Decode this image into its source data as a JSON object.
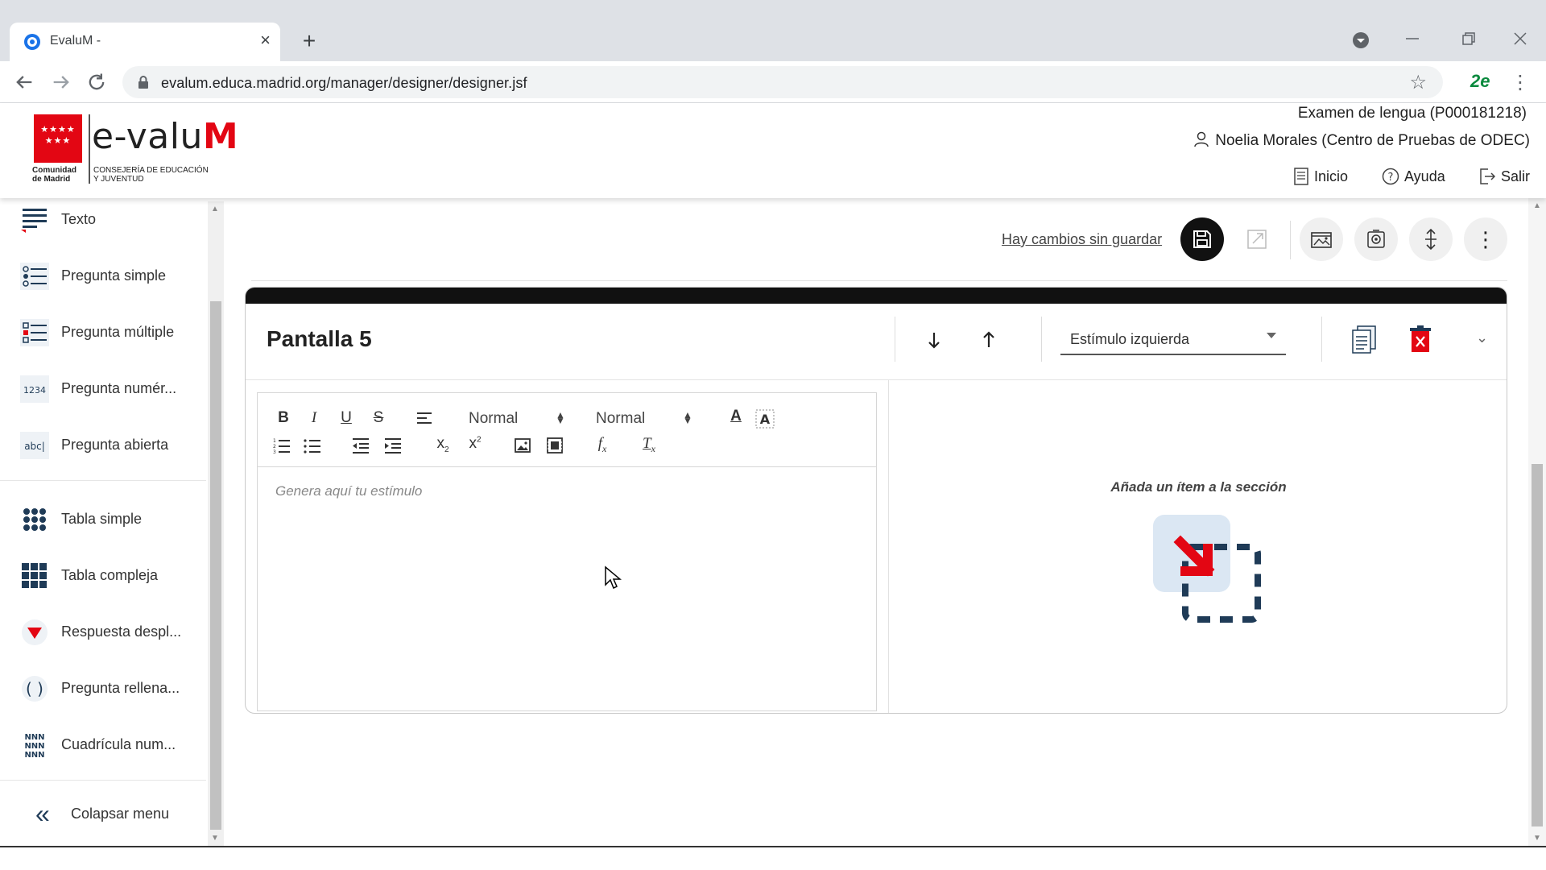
{
  "browser": {
    "tab_title": "EvaluM -",
    "tab_close": "×",
    "new_tab": "+",
    "url": "evalum.educa.madrid.org/manager/designer/designer.jsf",
    "extension_label": "2e"
  },
  "header": {
    "logo": {
      "brand_prefix": "e-valu",
      "brand_suffix": "M",
      "region_line1": "Comunidad",
      "region_line2": "de Madrid",
      "dept_line1": "CONSEJERÍA DE EDUCACIÓN",
      "dept_line2": "Y JUVENTUD"
    },
    "exam_title": "Examen de lengua  (P000181218)",
    "user": "Noelia Morales (Centro de Pruebas de ODEC)",
    "links": {
      "home": "Inicio",
      "help": "Ayuda",
      "logout": "Salir"
    }
  },
  "sidebar": {
    "items": [
      {
        "label": "Texto",
        "icon": "text-lines-icon"
      },
      {
        "label": "Pregunta simple",
        "icon": "single-choice-icon"
      },
      {
        "label": "Pregunta múltiple",
        "icon": "multiple-choice-icon"
      },
      {
        "label": "Pregunta numér...",
        "icon": "numeric-question-icon",
        "icon_text": "1234"
      },
      {
        "label": "Pregunta abierta",
        "icon": "open-question-icon",
        "icon_text": "abc|"
      },
      {
        "label": "Tabla simple",
        "icon": "simple-table-icon"
      },
      {
        "label": "Tabla compleja",
        "icon": "complex-table-icon"
      },
      {
        "label": "Respuesta despl...",
        "icon": "dropdown-answer-icon"
      },
      {
        "label": "Pregunta rellena...",
        "icon": "fill-in-question-icon",
        "icon_text": "( )"
      },
      {
        "label": "Cuadrícula num...",
        "icon": "number-grid-icon",
        "icon_text": "NNN"
      }
    ],
    "collapse_label": "Colapsar menu"
  },
  "main": {
    "unsaved_changes": "Hay cambios sin guardar",
    "screen": {
      "title": "Pantalla 5",
      "layout_select": "Estímulo izquierda",
      "editor": {
        "font_size": "Normal",
        "format": "Normal",
        "placeholder": "Genera aquí tu estímulo"
      },
      "add_item_text": "Añada un ítem a la sección"
    }
  },
  "colors": {
    "brand_red": "#e30613",
    "dark_button": "#111111",
    "accent_navy": "#1f3b57"
  }
}
